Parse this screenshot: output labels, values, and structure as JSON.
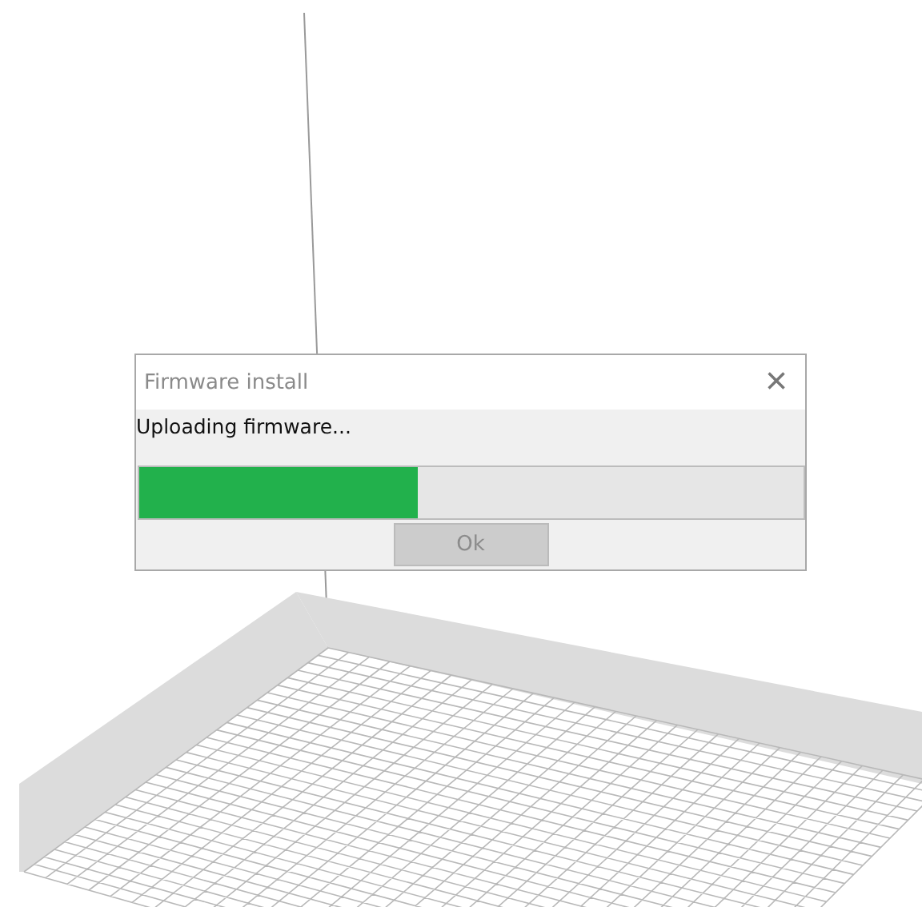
{
  "dialog": {
    "title": "Firmware install",
    "close_icon": "×",
    "message": "Uploading firmware...",
    "progress": {
      "level": 0.42
    },
    "buttons": [
      {
        "label": "Ok",
        "disabled": true
      }
    ]
  }
}
